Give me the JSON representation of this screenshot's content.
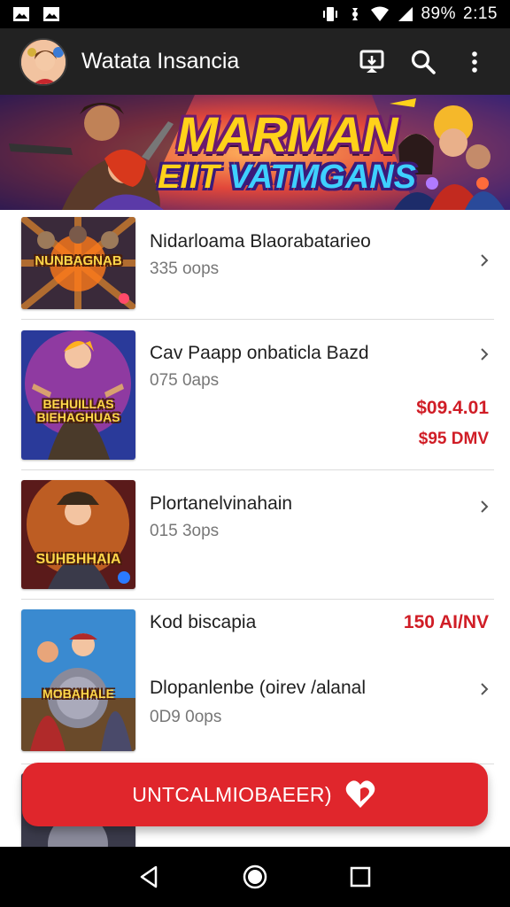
{
  "status_bar": {
    "battery": "89%",
    "time": "2:15",
    "icons": [
      "image-icon",
      "image-icon",
      "vibrate-icon",
      "data-icon",
      "wifi-icon",
      "signal-icon",
      "battery-icon"
    ]
  },
  "app_bar": {
    "title": "Watata Insancia",
    "actions": [
      "cast-icon",
      "search-icon",
      "more-vert-icon"
    ]
  },
  "banner": {
    "line1": "MARMAN",
    "line2_a": "EIIT ",
    "line2_b": "VATMGANS"
  },
  "list": {
    "items": [
      {
        "title": "Nidarloama Blaorabatarieo",
        "sub": "335 oops",
        "thumb_text": "NUNBAGNAB",
        "price": "",
        "price2": ""
      },
      {
        "title": "Cav Paapp onbaticla Bazd",
        "sub": "075 0aps",
        "thumb_text": "BEHUILLAS BIEHAGHUAS",
        "price": "$09.4.01",
        "price2": "$95 DMV"
      },
      {
        "title": "Plortanelvinahain",
        "sub": "015 3ops",
        "thumb_text": "SUHBHHAIA",
        "price": "",
        "price2": ""
      },
      {
        "title": "Kod biscapia",
        "title2": "Dlopanlenbe (oirev /alanal",
        "sub": "0D9 0ops",
        "thumb_text": "MOBAHALE",
        "price": "150 AI/NV",
        "price2": ""
      }
    ]
  },
  "fab": {
    "label": "UNTCALMIOBAEER)"
  },
  "nav": [
    "back-icon",
    "home-icon",
    "recents-icon"
  ],
  "colors": {
    "accent": "#e0262c",
    "appbar": "#222222",
    "price": "#d01d26"
  }
}
